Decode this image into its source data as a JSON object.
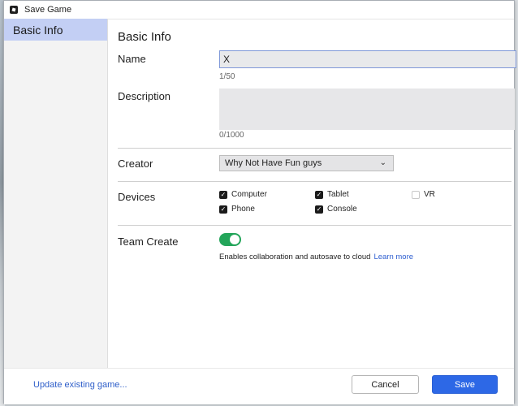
{
  "window": {
    "title": "Save Game"
  },
  "sidebar": {
    "items": [
      {
        "label": "Basic Info"
      }
    ]
  },
  "main": {
    "section_title": "Basic Info",
    "name": {
      "label": "Name",
      "value": "X",
      "counter": "1/50"
    },
    "description": {
      "label": "Description",
      "value": "",
      "counter": "0/1000"
    },
    "creator": {
      "label": "Creator",
      "selected": "Why Not Have Fun guys"
    },
    "devices": {
      "label": "Devices",
      "options": [
        {
          "label": "Computer",
          "checked": true
        },
        {
          "label": "Tablet",
          "checked": true
        },
        {
          "label": "VR",
          "checked": false
        },
        {
          "label": "Phone",
          "checked": true
        },
        {
          "label": "Console",
          "checked": true
        }
      ]
    },
    "team_create": {
      "label": "Team Create",
      "enabled": true,
      "hint": "Enables collaboration and autosave to cloud",
      "link": "Learn more"
    }
  },
  "footer": {
    "update_link": "Update existing game...",
    "cancel_label": "Cancel",
    "save_label": "Save"
  },
  "colors": {
    "accent": "#2d68e6",
    "toggle_on": "#23a55a",
    "sidebar_selected": "#c3cff4"
  }
}
